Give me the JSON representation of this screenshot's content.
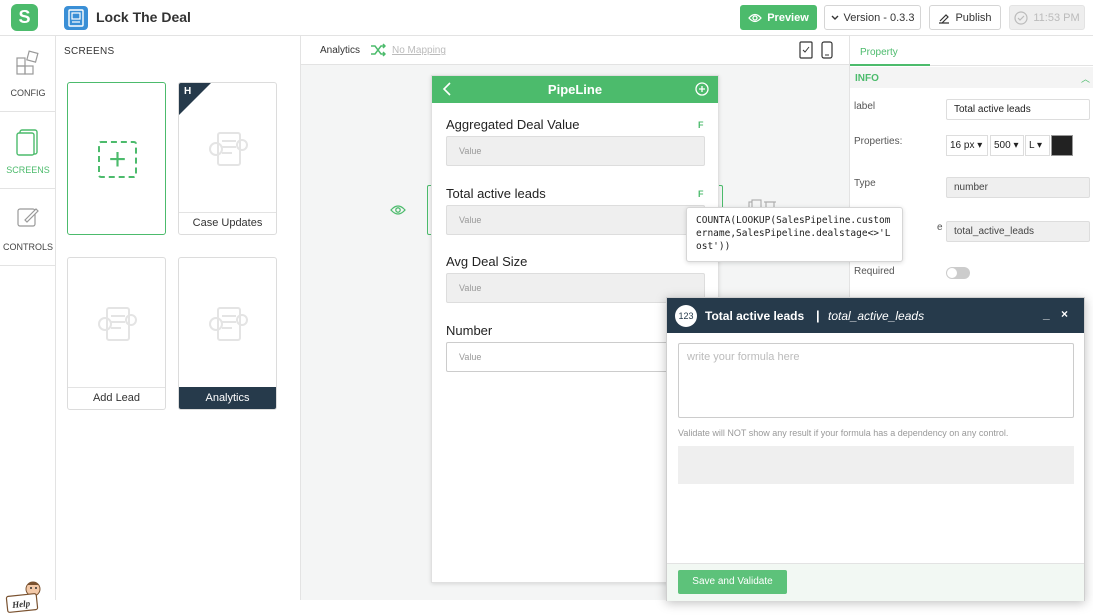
{
  "header": {
    "logo_letter": "S",
    "app_title": "Lock The Deal",
    "preview_label": "Preview",
    "version_label": "Version - 0.3.3",
    "publish_label": "Publish",
    "time_label": "11:53 PM"
  },
  "rail": {
    "items": [
      {
        "label": "CONFIG",
        "icon": "config-icon"
      },
      {
        "label": "SCREENS",
        "icon": "screens-icon",
        "active": true
      },
      {
        "label": "CONTROLS",
        "icon": "controls-icon"
      }
    ],
    "help_label": "Help"
  },
  "screens": {
    "title": "SCREENS",
    "cards": [
      {
        "label": "",
        "type": "add"
      },
      {
        "label": "Case Updates",
        "badge": "H"
      },
      {
        "label": "Add Lead"
      },
      {
        "label": "Analytics",
        "active": true
      }
    ]
  },
  "canvas": {
    "title": "Analytics",
    "mapping_label": "No Mapping",
    "phone": {
      "title": "PipeLine",
      "fields": [
        {
          "label": "Aggregated Deal Value",
          "flag": "F",
          "placeholder": "Value"
        },
        {
          "label": "Total active leads",
          "flag": "F",
          "placeholder": "Value"
        },
        {
          "label": "Avg Deal Size",
          "flag": "",
          "placeholder": "Value"
        },
        {
          "label": "Number",
          "flag": "",
          "placeholder": "Value"
        }
      ]
    },
    "tooltip": "COUNTA(LOOKUP(SalesPipeline.customername,SalesPipeline.dealstage<>'Lost'))"
  },
  "property": {
    "tab": "Property",
    "section": "INFO",
    "label_caption": "label",
    "label_value": "Total active leads",
    "properties_caption": "Properties:",
    "font_size": "16 px",
    "font_weight": "500",
    "align": "L",
    "text_color": "#222222",
    "type_caption": "Type",
    "type_value": "number",
    "varname_value": "total_active_leads",
    "varname_caption_fragment": "e",
    "required_caption": "Required",
    "required_on": false
  },
  "dialog": {
    "badge": "123",
    "title": "Total active leads",
    "separator": "|",
    "variable": "total_active_leads",
    "minimize": "_",
    "close": "×",
    "formula_placeholder": "write your formula here",
    "hint": "Validate will NOT show any result if your formula has a dependency on any control.",
    "save_label": "Save and Validate"
  },
  "colors": {
    "accent": "#4cbb6c",
    "dark": "#263a4b"
  }
}
